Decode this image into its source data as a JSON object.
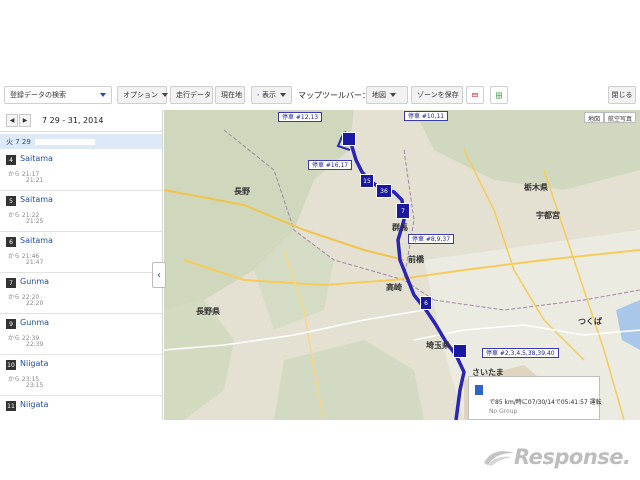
{
  "toolbar": {
    "search_value": "登録データの検索",
    "options_label": "オプション",
    "travel_data_label": "走行データ",
    "current_location_label": "現在地",
    "display_label": "表示",
    "map_toolbar_label": "マップツールバー：",
    "map_select_label": "地図",
    "save_zone_label": "ゾーンを保存",
    "close_label": "閉じる"
  },
  "panel": {
    "prev_glyph": "◀",
    "next_glyph": "▶",
    "date_range": "7 29 - 31, 2014",
    "day_label": "火 7 29",
    "items": [
      {
        "num": "4",
        "name": "Saitama",
        "from": "から 21:17",
        "to": "21:21"
      },
      {
        "num": "5",
        "name": "Saitama",
        "from": "から 21:22",
        "to": "21:25"
      },
      {
        "num": "6",
        "name": "Saitama",
        "from": "から 21:46",
        "to": "21:47"
      },
      {
        "num": "7",
        "name": "Gunma",
        "from": "から 22:20",
        "to": "22:20"
      },
      {
        "num": "9",
        "name": "Gunma",
        "from": "から 22:39",
        "to": "22:39"
      },
      {
        "num": "10",
        "name": "Niigata",
        "from": "から 23:15",
        "to": "23:15"
      },
      {
        "num": "11",
        "name": "Niigata",
        "from": "",
        "to": ""
      }
    ]
  },
  "map": {
    "map_type_map": "地図",
    "map_type_aerial": "航空写真",
    "stop_labels": [
      "停車 #12,13",
      "停車 #10,11",
      "停車 #16,17",
      "停車 #8,9,37",
      "停車 #2,3,4,5,38,39,40"
    ],
    "markers": [
      "15",
      "36",
      "7",
      "6"
    ],
    "cities": [
      "長野",
      "群馬",
      "前橋",
      "高崎",
      "宇都宮",
      "栃木県",
      "さいたま",
      "埼玉県",
      "長野県",
      "つくば"
    ],
    "info_text": "で85 km/時に07/30/14で05:41:57 運転",
    "info_group": "No Group",
    "route_color": "#2a25b5",
    "marker_color": "#1a1aa0"
  },
  "watermark": "Response."
}
